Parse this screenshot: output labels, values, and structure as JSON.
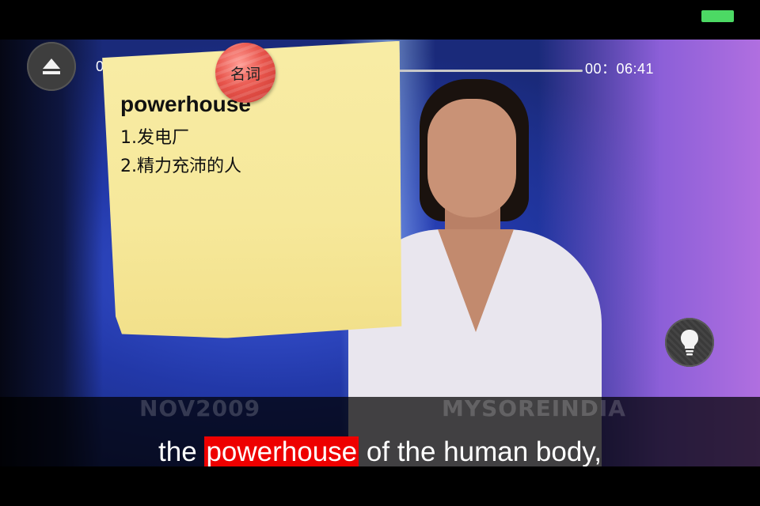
{
  "status_bar": {
    "battery_color": "#4cd964"
  },
  "player": {
    "current_time": "0",
    "total_time": "00：06:41",
    "eject_icon": "eject-icon",
    "hint_icon": "lightbulb-icon"
  },
  "video": {
    "watermark_left": "NOV2009",
    "watermark_right": "MYSOREINDIA"
  },
  "dictionary_note": {
    "part_of_speech": "名词",
    "word": "powerhouse",
    "definitions": [
      "1.发电厂",
      "2.精力充沛的人"
    ],
    "note_color": "#f7eaa0",
    "pin_color": "#e8554c"
  },
  "subtitle": {
    "before": "the",
    "highlight": "powerhouse",
    "after": "of the human body,",
    "highlight_color": "#ee0000"
  }
}
